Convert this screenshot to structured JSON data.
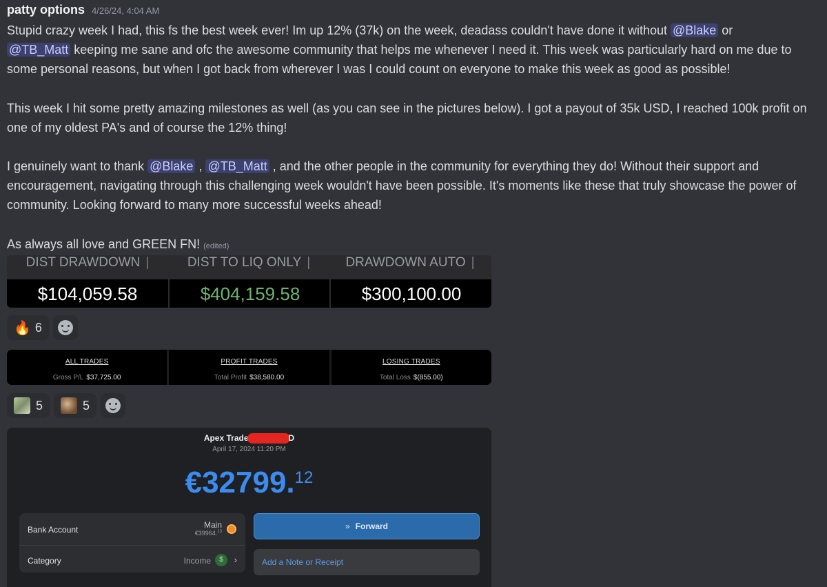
{
  "message": {
    "author": "patty options",
    "timestamp": "4/26/24, 4:04 AM",
    "p1_a": "Stupid crazy week I had, this fs the best week ever! Im up 12% (37k) on the week, deadass couldn't have done it without ",
    "mention_blake": "@Blake",
    "p1_b": " or",
    "mention_matt": "@TB_Matt",
    "p1_c": " keeping me sane and ofc the awesome community that helps me whenever I need it. This week was particularly hard on me due to some personal reasons, but when I got back from wherever I was I could count on everyone to make this week as good as possible!",
    "p2": "This week I hit some pretty amazing milestones as well (as you can see in the pictures below). I got a payout of 35k USD, I reached 100k profit on one of my oldest PA's and of course the 12% thing!",
    "p3_a": "I genuinely want to thank ",
    "p3_sep": " , ",
    "p3_b": " , and the other people in the community for everything they do! Without their support and encouragement, navigating through this challenging week wouldn't have been possible. It's moments like these that truly showcase the power of community. Looking forward to many more successful weeks ahead!",
    "p4": "As always all love and GREEN FN!",
    "edited": "(edited)"
  },
  "drawdown": [
    {
      "label": "DIST DRAWDOWN",
      "value": "$104,059.58",
      "color": "#ffffff"
    },
    {
      "label": "DIST TO LIQ ONLY",
      "value": "$404,159.58",
      "color": "#6fb36f"
    },
    {
      "label": "DRAWDOWN AUTO",
      "value": "$300,100.00",
      "color": "#ffffff"
    }
  ],
  "reactions1": [
    {
      "emoji": "fire-emoji",
      "glyph": "🔥",
      "count": "6"
    }
  ],
  "trades": [
    {
      "title": "ALL TRADES",
      "label": "Gross P/L",
      "value": "$37,725.00"
    },
    {
      "title": "PROFIT TRADES",
      "label": "Total Profit",
      "value": "$38,580.00"
    },
    {
      "title": "LOSING TRADES",
      "label": "Total Loss",
      "value": "$(855.00)"
    }
  ],
  "reactions2": [
    {
      "emoji": "money-emoji",
      "count": "5"
    },
    {
      "emoji": "custom-image-emoji",
      "count": "5"
    }
  ],
  "bank": {
    "name_prefix": "Apex Trade",
    "name_suffix": "D",
    "date": "April 17, 2024 11:20 PM",
    "amount_main": "€32799.",
    "amount_cents": "12",
    "account_label": "Bank Account",
    "account_name": "Main",
    "account_balance": "€39964.",
    "account_balance_cents": "13",
    "category_label": "Category",
    "category_value": "Income",
    "forward_label": "Forward",
    "note_label": "Add a Note or Receipt"
  }
}
